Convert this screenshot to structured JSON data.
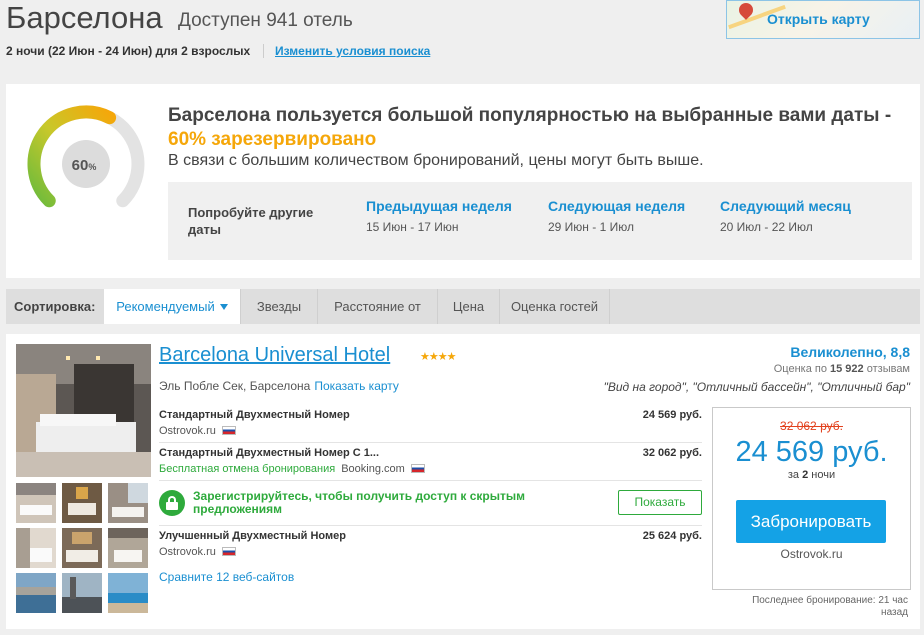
{
  "header": {
    "city": "Барселона",
    "availability": "Доступен 941 отель",
    "dates": "2 ночи (22 Июн - 24 Июн) для 2 взрослых",
    "change_link": "Изменить условия поиска",
    "map_button": "Открыть карту"
  },
  "popularity": {
    "gauge_value": "60",
    "gauge_unit": "%",
    "gauge_fraction": 0.6,
    "title_main": "Барселона пользуется большой популярностью на выбранные вами даты - ",
    "title_pct": "60% зарезервировано",
    "subtitle": "В связи с большим количеством бронирований, цены могут быть выше.",
    "try_label": "Попробуйте другие даты",
    "options": [
      {
        "title": "Предыдущая неделя",
        "dates": "15 Июн - 17 Июн"
      },
      {
        "title": "Следующая неделя",
        "dates": "29 Июн - 1 Июл"
      },
      {
        "title": "Следующий месяц",
        "dates": "20 Июл - 22 Июл"
      }
    ]
  },
  "sort": {
    "label": "Сортировка:",
    "options": [
      "Рекомендуемый",
      "Звезды",
      "Расстояние от",
      "Цена",
      "Оценка гостей"
    ],
    "active": "Рекомендуемый"
  },
  "hotel": {
    "name": "Barcelona Universal Hotel",
    "stars": "★★★★",
    "location": "Эль Побле Сек, Барселона",
    "show_map": "Показать карту",
    "rating": "Великолепно, 8,8",
    "reviews_prefix": "Оценка по",
    "reviews_count": "15 922",
    "reviews_suffix": "отзывам",
    "quotes": "\"Вид на город\", \"Отличный бассейн\", \"Отличный бар\"",
    "offers": [
      {
        "room": "Стандартный Двухместный Номер",
        "price": "24 569 руб.",
        "free_cancel": "",
        "site": "Ostrovok.ru"
      },
      {
        "room": "Стандартный Двухместный Номер С 1...",
        "price": "32 062 руб.",
        "free_cancel": "Бесплатная отмена бронирования",
        "site": "Booking.com"
      },
      {
        "room": "Улучшенный Двухместный Номер",
        "price": "25 624 руб.",
        "free_cancel": "",
        "site": "Ostrovok.ru"
      }
    ],
    "locked_text": "Зарегистрируйтесь, чтобы получить доступ к скрытым предложениям",
    "show_button": "Показать",
    "compare": "Сравните 12 веб-сайтов",
    "old_price": "32 062 руб.",
    "new_price": "24 569 руб.",
    "per_prefix": "за",
    "per_nights": "2",
    "per_suffix": "ночи",
    "book_button": "Забронировать",
    "book_source": "Ostrovok.ru",
    "last_booking": "Последнее бронирование: 21 час назад"
  },
  "colors": {
    "link": "#1a8fd1",
    "accent_orange": "#f5a70a",
    "green": "#2eaa3c",
    "old_price_red": "#e2411d",
    "book_button": "#14a2e6"
  }
}
